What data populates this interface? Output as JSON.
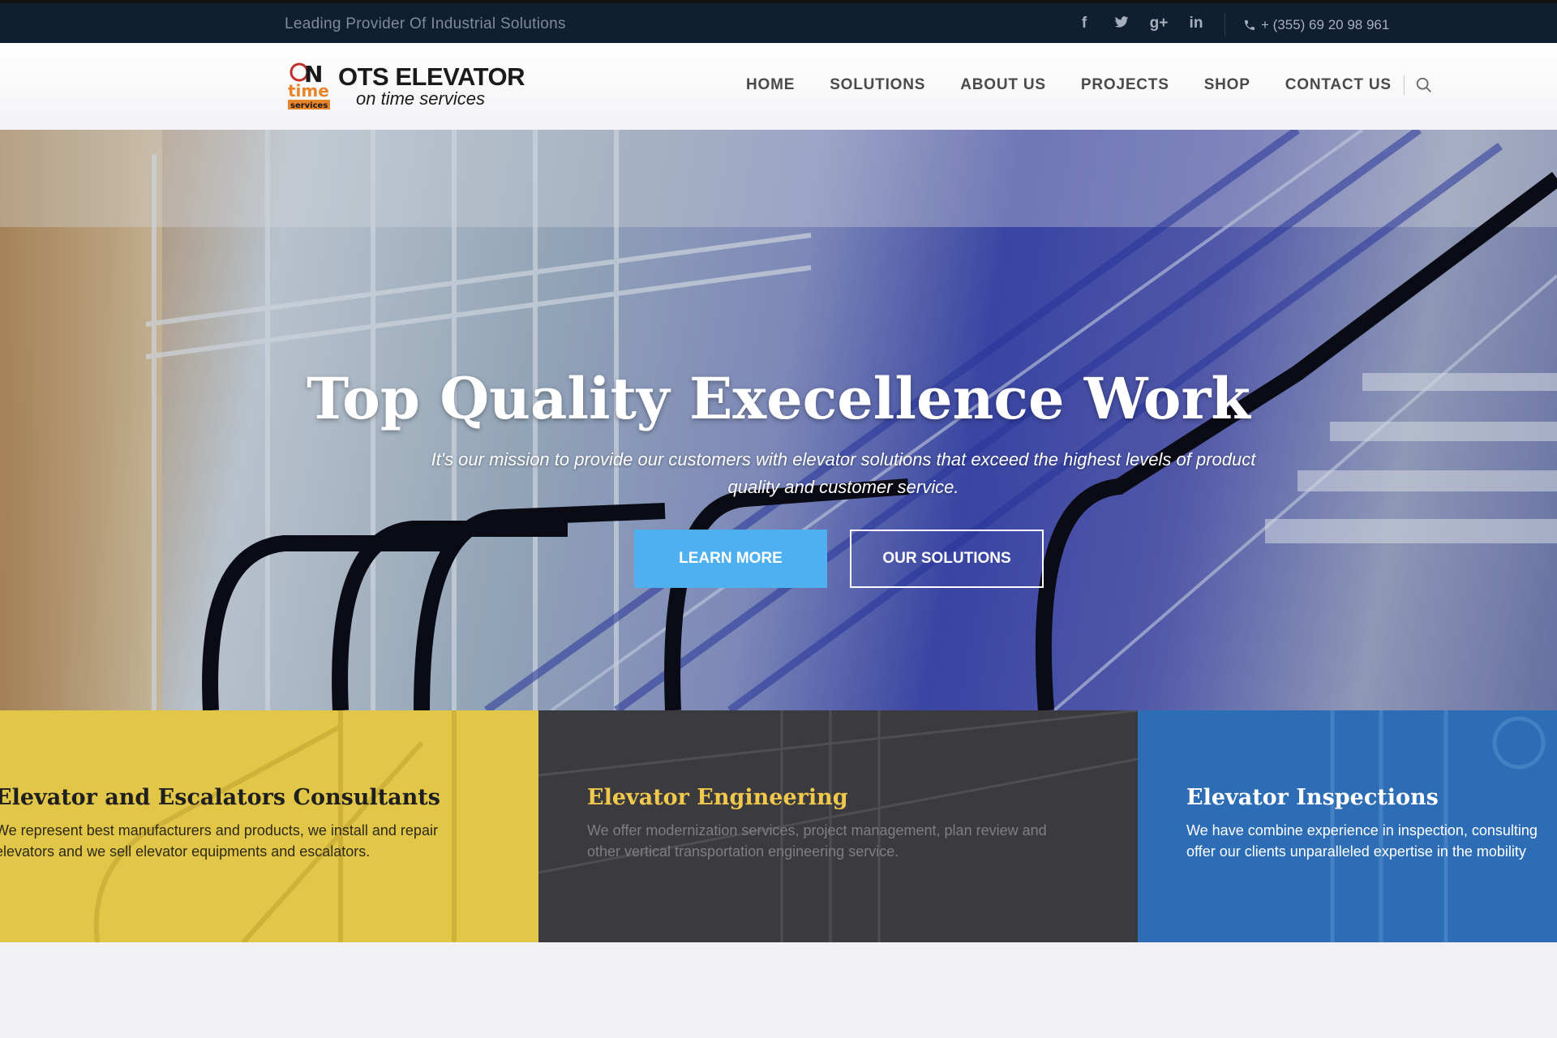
{
  "topbar": {
    "tagline": "Leading Provider Of Industrial Solutions",
    "socials": [
      {
        "icon": "facebook-icon",
        "glyph": "f"
      },
      {
        "icon": "twitter-icon",
        "glyph": "t"
      },
      {
        "icon": "google-plus-icon",
        "glyph": "g+"
      },
      {
        "icon": "linkedin-icon",
        "glyph": "in"
      }
    ],
    "phone": "+ (355) 69 20 98 961"
  },
  "header": {
    "logo": {
      "brand": "OTS ELEVATOR",
      "sub": "on time services",
      "mark_text": [
        "ON",
        "time",
        "services"
      ]
    },
    "nav": [
      "HOME",
      "SOLUTIONS",
      "ABOUT US",
      "PROJECTS",
      "SHOP",
      "CONTACT US"
    ]
  },
  "hero": {
    "title": "Top Quality Execellence Work",
    "subtitle": "It's our mission to provide our customers with elevator solutions that exceed the highest levels of product quality and customer service.",
    "buttons": {
      "learn": "LEARN MORE",
      "solutions": "OUR SOLUTIONS"
    },
    "accent": "#4fb0ef"
  },
  "features": [
    {
      "title": "Elevator and Escalators Consultants",
      "lines": [
        "We represent best manufacturers and products, we install and repair",
        "elevators and we sell elevator equipments and escalators."
      ],
      "color": "#e2c648"
    },
    {
      "title": "Elevator Engineering",
      "lines": [
        "We offer modernization services, project management, plan review and",
        "other vertical transportation engineering service."
      ],
      "color": "#3b3b3f"
    },
    {
      "title": "Elevator Inspections",
      "lines": [
        "We have combine experience in inspection, consulting",
        "offer our clients unparalleled expertise in the mobility"
      ],
      "color": "#2c6db5"
    }
  ]
}
